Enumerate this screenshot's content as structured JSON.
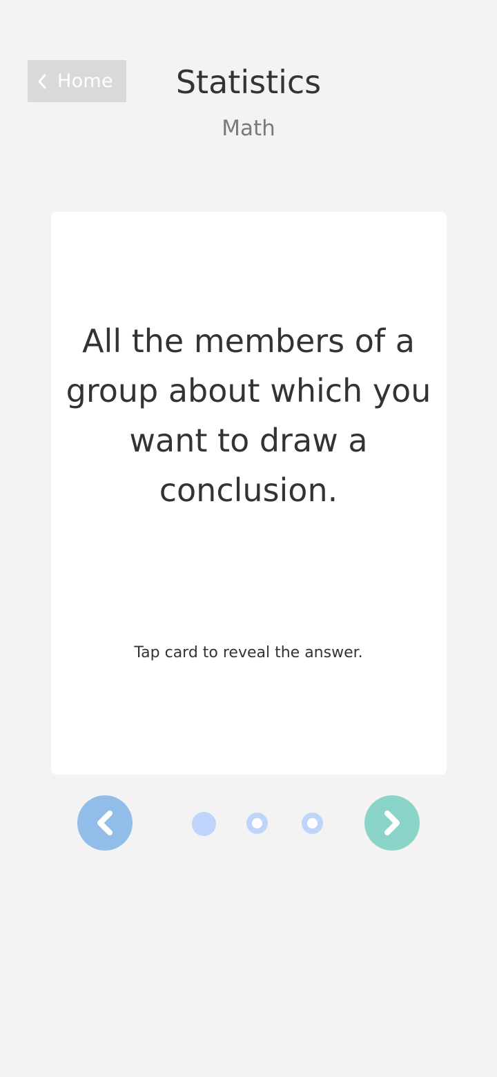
{
  "header": {
    "home_label": "Home",
    "title": "Statistics",
    "subtitle": "Math"
  },
  "card": {
    "question": "All the members of a group about which you want to draw a conclusion.",
    "hint": "Tap card to reveal the answer."
  },
  "pagination": {
    "total": 3,
    "current": 1
  },
  "icons": {
    "back": "chevron-left-icon",
    "prev": "chevron-left-icon",
    "next": "chevron-right-icon"
  },
  "colors": {
    "background": "#f3f3f3",
    "home_button": "#d9d9d9",
    "prev_button": "#92bde8",
    "next_button": "#8ad3c8",
    "dot": "#bfd4fb",
    "text": "#333333",
    "subtitle": "#7a7a7a"
  }
}
